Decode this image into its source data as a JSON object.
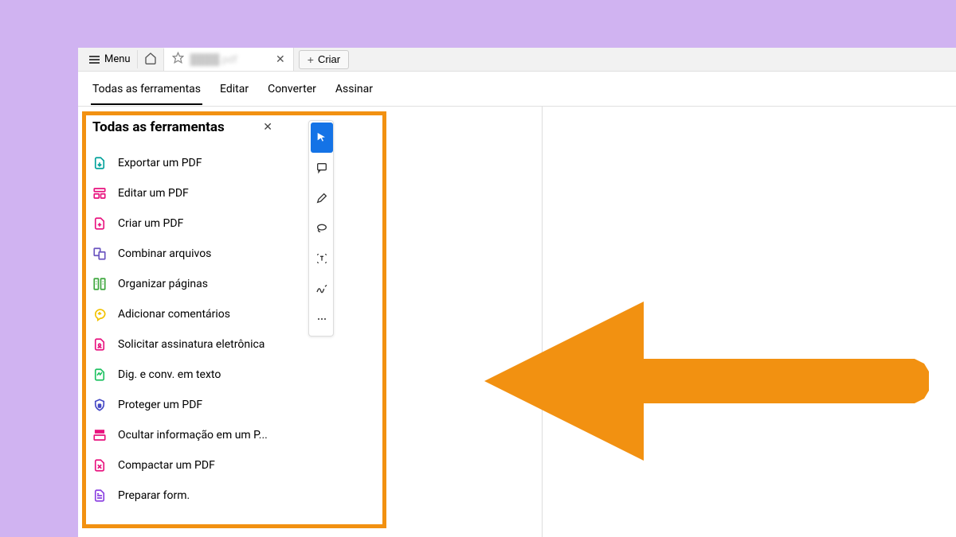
{
  "topbar": {
    "menu_label": "Menu",
    "create_label": "Criar"
  },
  "nav": {
    "tabs": [
      {
        "label": "Todas as ferramentas",
        "active": true
      },
      {
        "label": "Editar",
        "active": false
      },
      {
        "label": "Converter",
        "active": false
      },
      {
        "label": "Assinar",
        "active": false
      }
    ]
  },
  "sidebar": {
    "title": "Todas as ferramentas",
    "tools": [
      {
        "label": "Exportar um PDF",
        "icon": "export",
        "color": "#00a19a"
      },
      {
        "label": "Editar um PDF",
        "icon": "edit",
        "color": "#e8127e"
      },
      {
        "label": "Criar um PDF",
        "icon": "create",
        "color": "#e8127e"
      },
      {
        "label": "Combinar arquivos",
        "icon": "combine",
        "color": "#6b55c0"
      },
      {
        "label": "Organizar páginas",
        "icon": "organize",
        "color": "#3da63d"
      },
      {
        "label": "Adicionar comentários",
        "icon": "comment",
        "color": "#f2c200"
      },
      {
        "label": "Solicitar assinatura eletrônica",
        "icon": "request-sign",
        "color": "#e8127e"
      },
      {
        "label": "Dig. e conv. em texto",
        "icon": "scan",
        "color": "#1dc160"
      },
      {
        "label": "Proteger um PDF",
        "icon": "protect",
        "color": "#4548c4"
      },
      {
        "label": "Ocultar informação em um P...",
        "icon": "redact",
        "color": "#e8127e"
      },
      {
        "label": "Compactar um PDF",
        "icon": "compress",
        "color": "#e8127e"
      },
      {
        "label": "Preparar form.",
        "icon": "form",
        "color": "#8a3fe0"
      }
    ]
  },
  "toolbar": {
    "items": [
      {
        "name": "select",
        "active": true
      },
      {
        "name": "comment",
        "active": false
      },
      {
        "name": "highlight",
        "active": false
      },
      {
        "name": "draw",
        "active": false
      },
      {
        "name": "text-select",
        "active": false
      },
      {
        "name": "sign",
        "active": false
      },
      {
        "name": "more",
        "active": false
      }
    ]
  },
  "annotation": {
    "highlight_color": "#f29111",
    "arrow_color": "#f29111"
  }
}
